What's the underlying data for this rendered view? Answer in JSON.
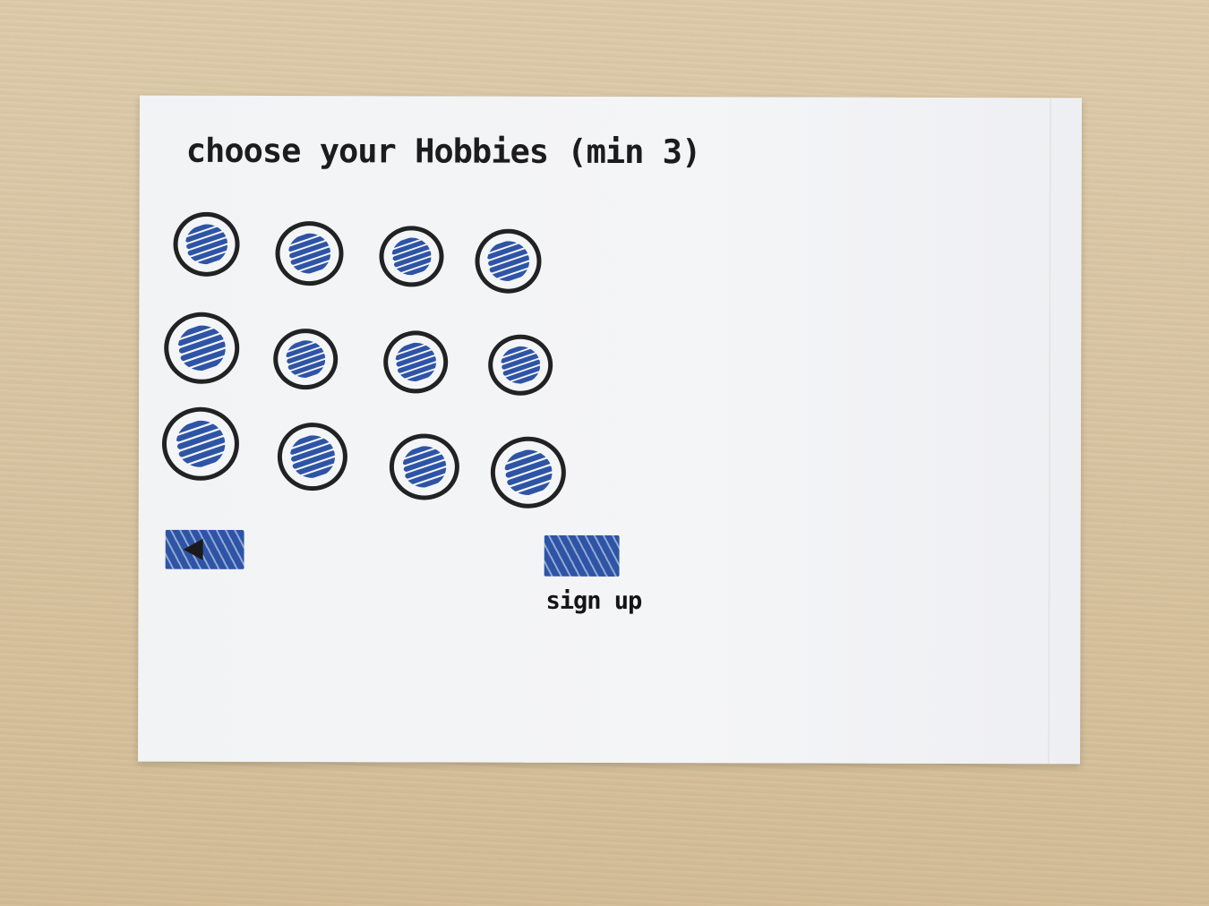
{
  "screen": {
    "title": "choose your Hobbies (min 3)",
    "signup_label": "sign up"
  },
  "colors": {
    "ink": "#222222",
    "marker_blue": "#2e54a6",
    "paper": "#f4f5f7"
  },
  "icons": {
    "back": "left-arrow-icon"
  }
}
